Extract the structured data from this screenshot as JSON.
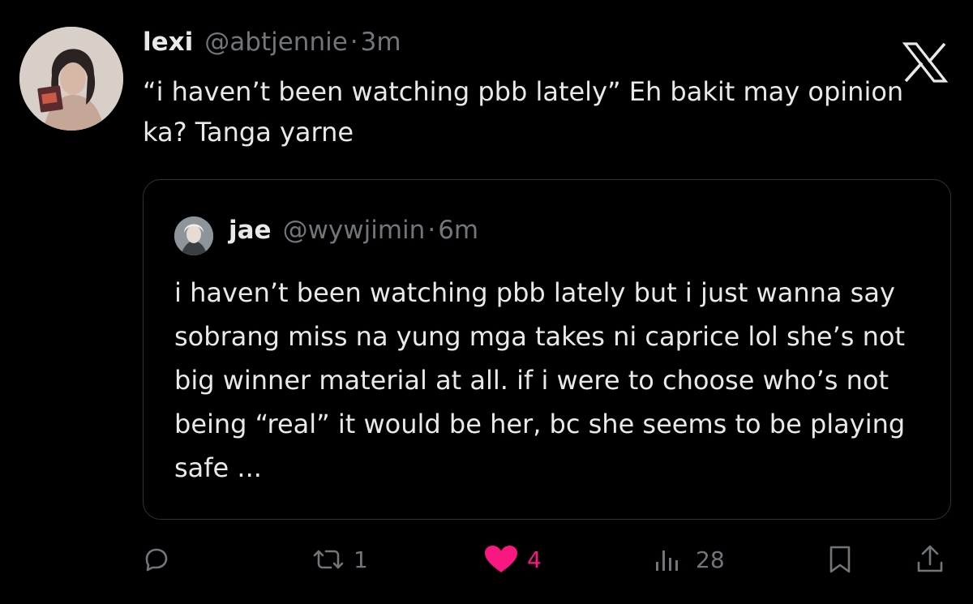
{
  "tweet": {
    "display_name": "lexi",
    "handle": "@abtjennie",
    "separator": "·",
    "time": "3m",
    "text": "“i haven’t been watching pbb lately” Eh bakit may opinion ka? Tanga yarne"
  },
  "quoted_tweet": {
    "display_name": "jae",
    "handle": "@wywjimin",
    "separator": "·",
    "time": "6m",
    "text": "i haven’t been watching pbb lately but i just wanna say sobrang miss na yung mga takes ni caprice lol she’s not big winner material at all. if i were to choose who’s not being “real” it would be her, bc she seems to be playing safe ..."
  },
  "actions": {
    "reply": {
      "icon": "reply-icon"
    },
    "repost": {
      "icon": "repost-icon",
      "count": "1"
    },
    "like": {
      "icon": "heart-icon",
      "count": "4",
      "liked": true,
      "color": "#f91880"
    },
    "views": {
      "icon": "views-icon",
      "count": "28"
    },
    "bookmark": {
      "icon": "bookmark-icon"
    },
    "share": {
      "icon": "share-icon"
    }
  },
  "colors": {
    "background": "#000000",
    "primary_text": "#e7e9ea",
    "secondary_text": "#71767b",
    "border": "#2f3336",
    "like": "#f91880"
  }
}
